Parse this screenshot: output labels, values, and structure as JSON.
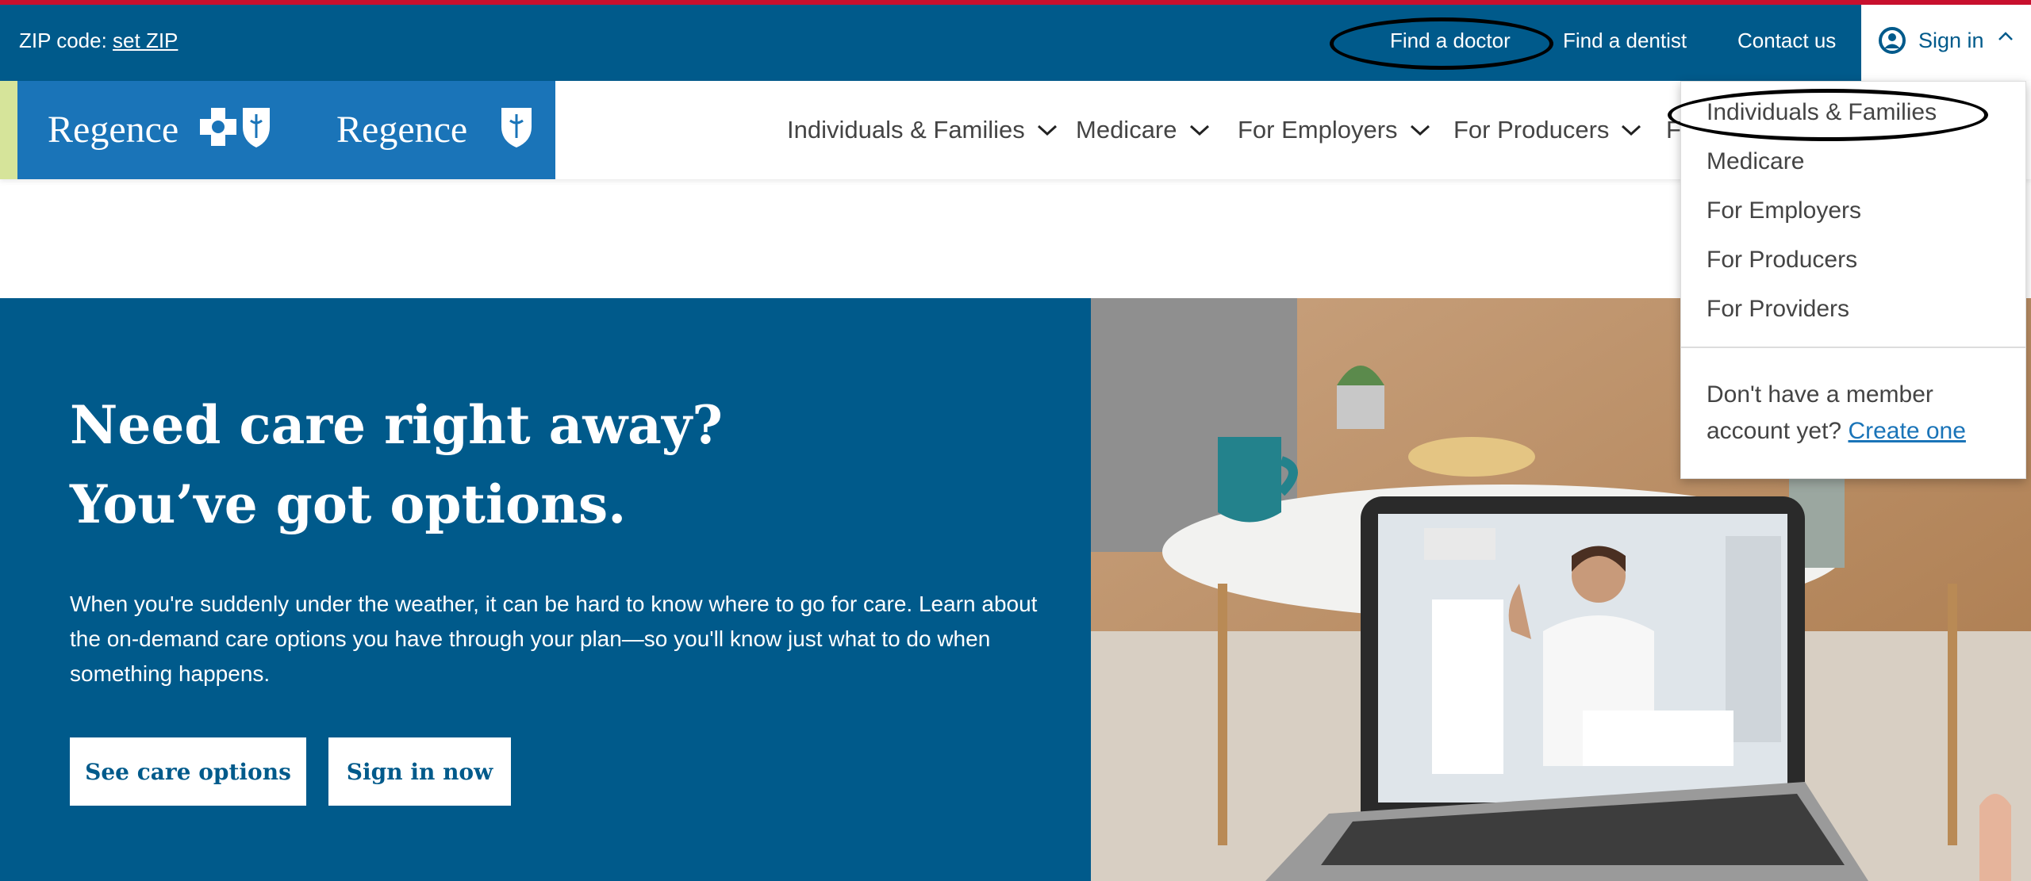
{
  "utility_bar": {
    "zip_label": "ZIP code:",
    "zip_link": "set ZIP",
    "find_doctor": "Find a doctor",
    "find_dentist": "Find a dentist",
    "contact_us": "Contact us",
    "sign_in": "Sign in"
  },
  "logos": [
    "Regence",
    "Regence"
  ],
  "nav": {
    "items": [
      {
        "label": "Individuals & Families"
      },
      {
        "label": "Medicare"
      },
      {
        "label": "For Employers"
      },
      {
        "label": "For Producers"
      },
      {
        "label": "F"
      }
    ]
  },
  "signin_dropdown": {
    "items": [
      "Individuals & Families",
      "Medicare",
      "For Employers",
      "For Producers",
      "For Providers"
    ],
    "note_text": "Don't have a member account yet?",
    "note_link": "Create one"
  },
  "hero": {
    "title_line1": "Need care right away?",
    "title_line2": "You’ve got options.",
    "body": "When you're suddenly under the weather, it can be hard to know where to go for care. Learn about the on-demand care options you have through your plan—so you'll know just what to do when something happens.",
    "button_primary": "See care options",
    "button_secondary": "Sign in now"
  },
  "colors": {
    "brand_blue": "#005a8b",
    "logo_blue": "#1a74b8",
    "accent_red": "#c8102e",
    "accent_lime": "#d6e49a"
  }
}
